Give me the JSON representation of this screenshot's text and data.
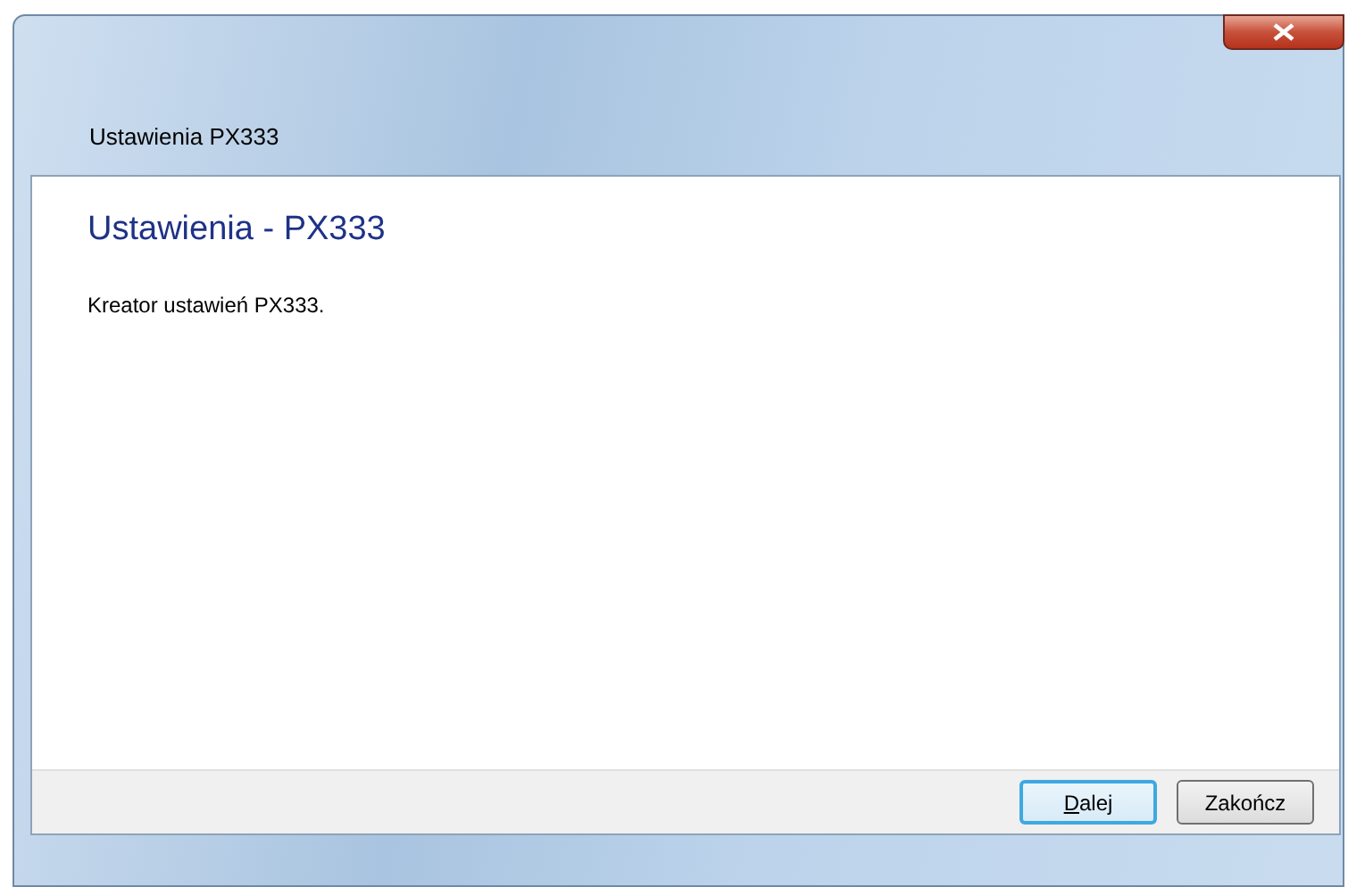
{
  "window": {
    "title": "Ustawienia PX333"
  },
  "content": {
    "heading": "Ustawienia - PX333",
    "description": "Kreator ustawień PX333."
  },
  "buttons": [
    {
      "label": "Dalej",
      "default": true,
      "mnemonic": true
    },
    {
      "label": "Zakończ",
      "default": false,
      "mnemonic": false
    }
  ]
}
